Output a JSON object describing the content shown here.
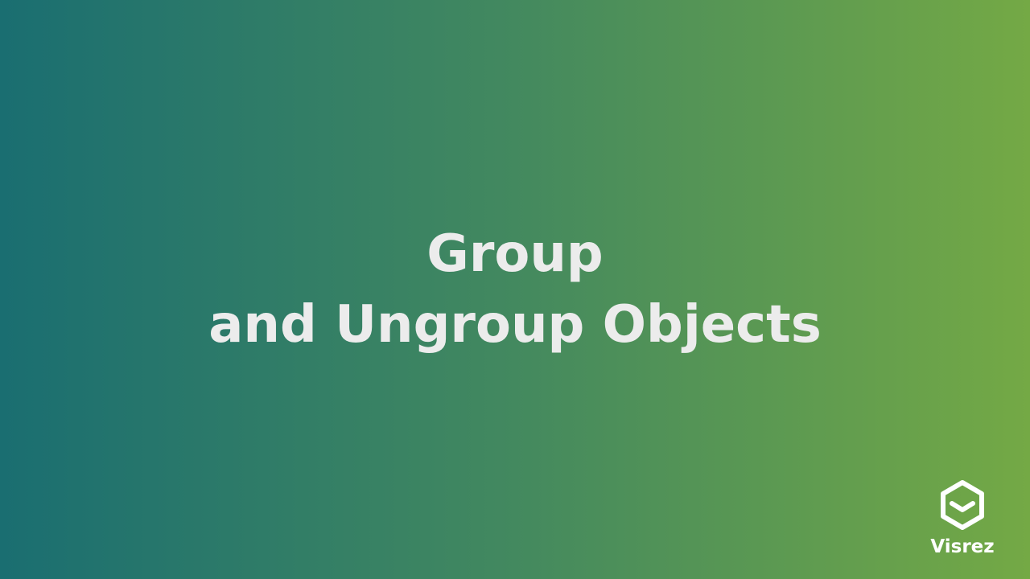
{
  "slide": {
    "title_line_1": "Group",
    "title_line_2": "and Ungroup Objects"
  },
  "brand": {
    "name": "Visrez",
    "icon": "visrez-logo-icon"
  },
  "colors": {
    "gradient_left": "#1a6e71",
    "gradient_mid": "#43895f",
    "gradient_right": "#74a945",
    "title_text": "#ececec",
    "brand_text": "#ffffff"
  }
}
